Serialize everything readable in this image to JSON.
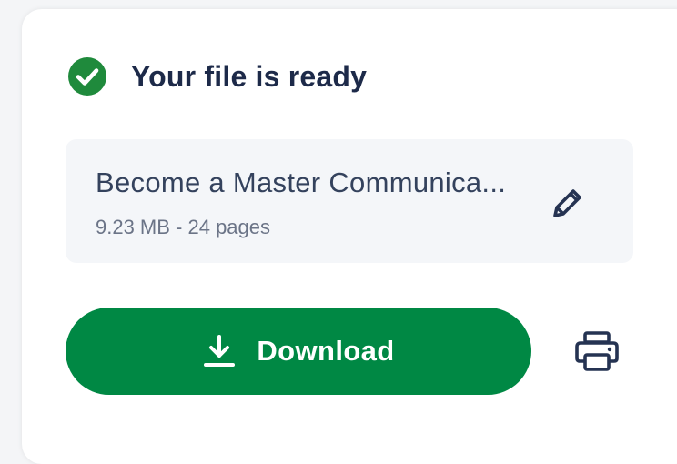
{
  "status": {
    "text": "Your file is ready",
    "icon": "check-circle-icon",
    "color": "#1f8a3c"
  },
  "file": {
    "name": "Become a Master Communica...",
    "meta": "9.23 MB - 24 pages",
    "edit_icon": "pencil-icon"
  },
  "actions": {
    "download_label": "Download",
    "download_icon": "download-icon",
    "download_color": "#008844",
    "print_icon": "printer-icon"
  },
  "colors": {
    "heading": "#1d2a49",
    "file_box_bg": "#f4f6f9"
  }
}
